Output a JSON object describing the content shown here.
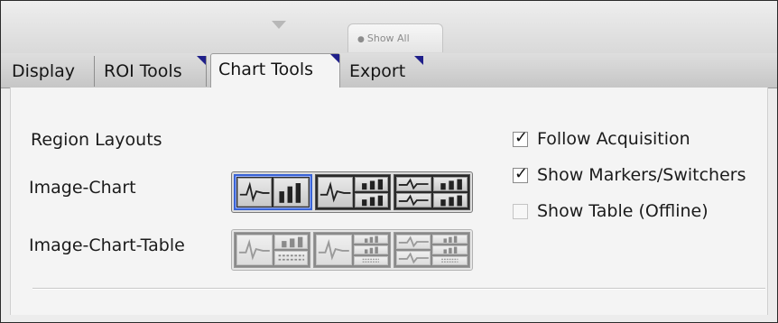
{
  "ribbon": {
    "show_all_label": "Show All",
    "tabs": [
      {
        "label": "Display",
        "active": false
      },
      {
        "label": "ROI Tools",
        "active": false
      },
      {
        "label": "Chart Tools",
        "active": true
      },
      {
        "label": "Export",
        "active": false
      }
    ]
  },
  "region_layouts": {
    "heading": "Region Layouts",
    "image_chart_label": "Image-Chart",
    "image_chart_table_label": "Image-Chart-Table",
    "selected_layout": "image-chart-layout-1",
    "image_chart_table_enabled": false
  },
  "options": {
    "follow_acquisition": {
      "label": "Follow Acquisition",
      "checked": true
    },
    "show_markers": {
      "label": "Show Markers/Switchers",
      "checked": true
    },
    "show_table": {
      "label": "Show Table (Offline)",
      "checked": false,
      "enabled": false
    }
  },
  "colors": {
    "selection": "#3a64d6",
    "tab_corner": "#1f1f8a"
  }
}
